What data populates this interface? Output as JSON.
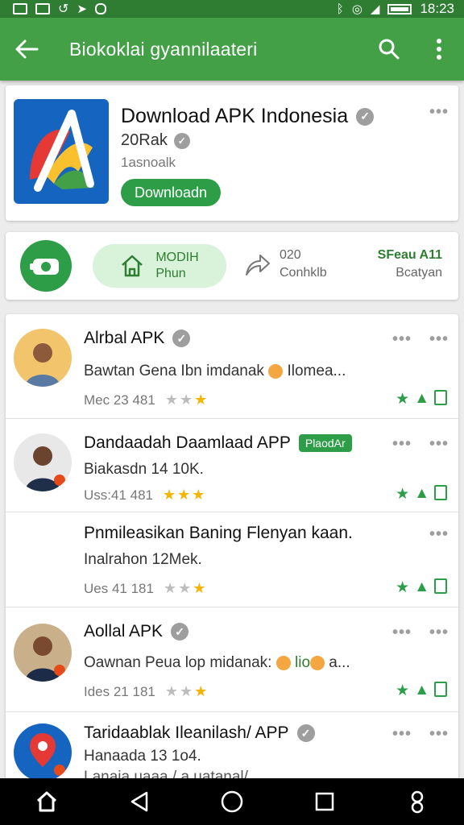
{
  "status_bar": {
    "time": "18:23"
  },
  "app_bar": {
    "title": "Biokoklai gyannilaateri"
  },
  "app": {
    "title": "Download APK Indonesia",
    "size": "20Rak",
    "subtitle": "1asnoalk",
    "download_label": "Downloadn"
  },
  "actions": {
    "pill_line1": "MODIH",
    "pill_line2": "Phun",
    "share_line1": "020",
    "share_line2": "Conhklb",
    "right_line1": "SFeau A11",
    "right_line2": "Bcatyan"
  },
  "items": [
    {
      "title": "Alrbal APK",
      "line": "Bawtan Gena Ibn imdanak ",
      "line_suffix": "Ilomea...",
      "meta": "Mec 23 481",
      "stars_on": 1
    },
    {
      "title": "Dandaadah Daamlaad APP",
      "badge": "PlaodAr",
      "line": "Biakasdn 14 10K.",
      "meta": "Uss:41 481",
      "stars_on": 3
    },
    {
      "title": "Pnmileasikan Baning Flenyan kaan.",
      "line": "Inalrahon 12Mek.",
      "meta": "Ues 41 181",
      "stars_on": 1
    },
    {
      "title": "Aollal APK",
      "line": "Oawnan Peua lop midanak: ",
      "line_suffix": "lio",
      "line_tail": "a...",
      "meta": "Ides 21 181",
      "stars_on": 1
    },
    {
      "title": "Taridaablak Ileanilash/ APP",
      "line": "Hanaada 13 1o4.",
      "line2": "Lanaia uaaa / a uatanal/"
    }
  ],
  "colors": {
    "accent": "#43a047",
    "dark": "#2e7d32",
    "button": "#2e9d48",
    "star": "#f4b400"
  }
}
